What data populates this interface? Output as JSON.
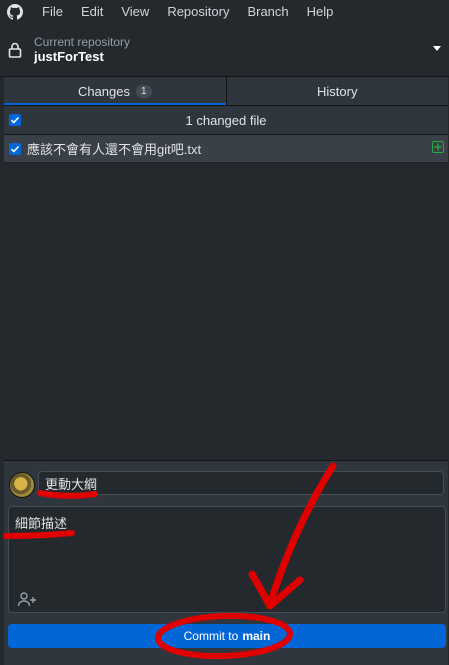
{
  "menubar": {
    "icon": "github-icon",
    "items": [
      "File",
      "Edit",
      "View",
      "Repository",
      "Branch",
      "Help"
    ]
  },
  "repository": {
    "label": "Current repository",
    "name": "justForTest"
  },
  "tabs": [
    {
      "label": "Changes",
      "badge": "1",
      "active": true
    },
    {
      "label": "History",
      "active": false
    }
  ],
  "changes": {
    "header": "1 changed file",
    "files": [
      {
        "name": "應該不會有人還不會用git吧.txt",
        "status": "added",
        "checked": true
      }
    ]
  },
  "commit": {
    "summary": "更動大綱",
    "description": "細節描述",
    "button_prefix": "Commit to",
    "branch": "main"
  },
  "colors": {
    "accent": "#0366d6",
    "added": "#28a745",
    "annotation": "#e00000"
  }
}
